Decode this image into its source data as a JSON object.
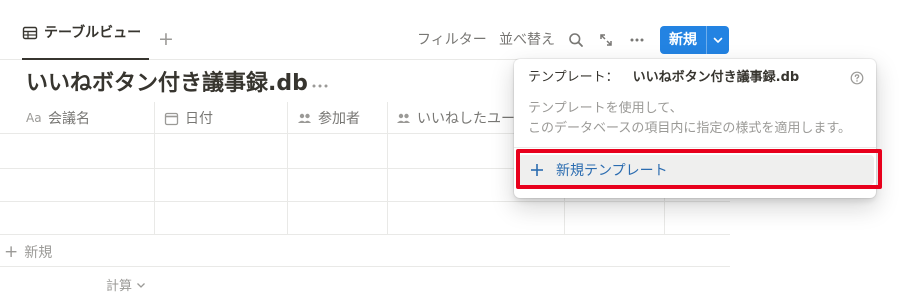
{
  "tabbar": {
    "active_tab": "テーブルビュー",
    "add_tab": "+",
    "filter": "フィルター",
    "sort": "並べ替え",
    "new_button": "新規"
  },
  "database": {
    "title": "いいねボタン付き議事録.db"
  },
  "table": {
    "columns": [
      {
        "label": "会議名",
        "icon": "text-property-icon",
        "type_glyph": "Aa"
      },
      {
        "label": "日付",
        "icon": "calendar-icon"
      },
      {
        "label": "参加者",
        "icon": "people-icon"
      },
      {
        "label": "いいねしたユー",
        "icon": "people-icon"
      }
    ],
    "add_row": "新規",
    "calculate": "計算"
  },
  "menu": {
    "header_label": "テンプレート：",
    "header_db": "いいねボタン付き議事録.db",
    "description_line1": "テンプレートを使用して、",
    "description_line2": "このデータベースの項目内に指定の様式を適用します。",
    "new_template": "新規テンプレート"
  },
  "colors": {
    "accent": "#2383e2",
    "highlight": "#e8001c",
    "menu_item_text": "#2b6cb0"
  }
}
